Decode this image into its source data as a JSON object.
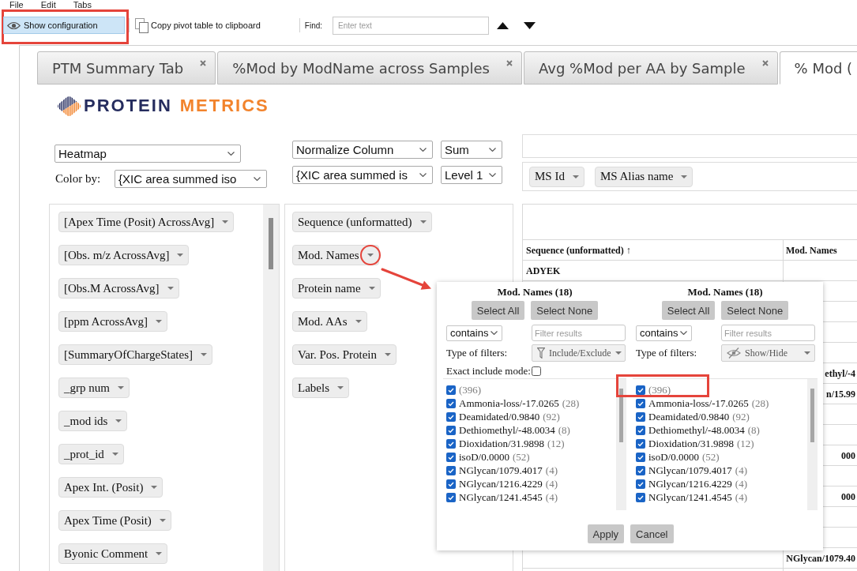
{
  "menu": [
    "File",
    "Edit",
    "Tabs"
  ],
  "toolbar": {
    "show_configuration": {
      "label": "Show configuration",
      "active": true,
      "highlighted": true
    },
    "copy_button": {
      "label": "Copy pivot table to clipboard"
    },
    "find": {
      "label": "Find:",
      "placeholder": "Enter text"
    }
  },
  "tabs": [
    {
      "label": "PTM Summary Tab",
      "selected": false,
      "closable": true
    },
    {
      "label": "%Mod by ModName across Samples",
      "selected": false,
      "closable": true
    },
    {
      "label": "Avg %Mod per AA by Sample",
      "selected": false,
      "closable": true
    },
    {
      "label": "% Mod (",
      "selected": true,
      "closable": false
    }
  ],
  "logo": {
    "primary": "PROTEIN",
    "secondary": "METRICS"
  },
  "renderer_select": {
    "value": "Heatmap"
  },
  "color_by": {
    "label": "Color by:",
    "value": "{XIC area summed iso"
  },
  "aggregator_rows": [
    {
      "main": "Normalize Column",
      "side": "Sum"
    },
    {
      "main": "{XIC area summed is",
      "side": "Level 1"
    }
  ],
  "column_fields": [
    "MS Id",
    "MS Alias name"
  ],
  "field_list": [
    "[Apex Time (Posit) AcrossAvg]",
    "[Obs. m/z AcrossAvg]",
    "[Obs.M AcrossAvg]",
    "[ppm AcrossAvg]",
    "[SummaryOfChargeStates]",
    "_grp num",
    "_mod ids",
    "_prot_id",
    "Apex Int. (Posit)",
    "Apex Time (Posit)",
    "Byonic Comment"
  ],
  "row_fields": [
    {
      "label": "Sequence (unformatted)",
      "highlighted": false
    },
    {
      "label": "Mod. Names",
      "highlighted": true
    },
    {
      "label": "Protein name",
      "highlighted": false
    },
    {
      "label": "Mod. AAs",
      "highlighted": false
    },
    {
      "label": "Var. Pos. Protein",
      "highlighted": false
    },
    {
      "label": "Labels",
      "highlighted": false
    }
  ],
  "table": {
    "columns": [
      "Sequence (unformatted) ↑",
      "Mod. Names"
    ],
    "rows": [
      {
        "sequence": "ADYEK"
      },
      {},
      {},
      {},
      {},
      {
        "mod_names": "ethyl/-4"
      },
      {
        "mod_names": "n/15.99"
      },
      {},
      {},
      {
        "mod_names": "000"
      },
      {},
      {
        "mod_names": "000"
      },
      {},
      {},
      {
        "mod_names": "NGlycan/1079.40"
      }
    ]
  },
  "filter_popup": {
    "panels": [
      {
        "title": "Mod. Names (18)",
        "buttons": [
          "Select All",
          "Select None"
        ],
        "match": "contains",
        "filter_placeholder": "Filter results",
        "filter_type_label": "Type of filters:",
        "filter_type": {
          "kind": "include_exclude",
          "label": "Include/Exclude"
        },
        "exact_include": {
          "label": "Exact include mode:",
          "checked": false
        },
        "items": [
          {
            "count": "(396)",
            "checked": true,
            "highlighted": false
          },
          {
            "name": "Ammonia-loss/-17.0265",
            "count": "(28)",
            "checked": true,
            "highlighted": false
          },
          {
            "name": "Deamidated/0.9840",
            "count": "(92)",
            "checked": true,
            "highlighted": false
          },
          {
            "name": "Dethiomethyl/-48.0034",
            "count": "(8)",
            "checked": true,
            "highlighted": false
          },
          {
            "name": "Dioxidation/31.9898",
            "count": "(12)",
            "checked": true,
            "highlighted": false
          },
          {
            "name": "isoD/0.0000",
            "count": "(52)",
            "checked": true,
            "highlighted": false
          },
          {
            "name": "NGlycan/1079.4017",
            "count": "(4)",
            "checked": true,
            "highlighted": false
          },
          {
            "name": "NGlycan/1216.4229",
            "count": "(4)",
            "checked": true,
            "highlighted": false
          },
          {
            "name": "NGlycan/1241.4545",
            "count": "(4)",
            "checked": true,
            "highlighted": false
          }
        ]
      },
      {
        "title": "Mod. Names (18)",
        "buttons": [
          "Select All",
          "Select None"
        ],
        "match": "contains",
        "filter_placeholder": "Filter results",
        "filter_type_label": "Type of filters:",
        "filter_type": {
          "kind": "show_hide",
          "label": "Show/Hide"
        },
        "items": [
          {
            "count": "(396)",
            "checked": true,
            "highlighted": true
          },
          {
            "name": "Ammonia-loss/-17.0265",
            "count": "(28)",
            "checked": true,
            "highlighted": false
          },
          {
            "name": "Deamidated/0.9840",
            "count": "(92)",
            "checked": true,
            "highlighted": false
          },
          {
            "name": "Dethiomethyl/-48.0034",
            "count": "(8)",
            "checked": true,
            "highlighted": false
          },
          {
            "name": "Dioxidation/31.9898",
            "count": "(12)",
            "checked": true,
            "highlighted": false
          },
          {
            "name": "isoD/0.0000",
            "count": "(52)",
            "checked": true,
            "highlighted": false
          },
          {
            "name": "NGlycan/1079.4017",
            "count": "(4)",
            "checked": true,
            "highlighted": false
          },
          {
            "name": "NGlycan/1216.4229",
            "count": "(4)",
            "checked": true,
            "highlighted": false
          },
          {
            "name": "NGlycan/1241.4545",
            "count": "(4)",
            "checked": true,
            "highlighted": false
          }
        ]
      }
    ],
    "buttons": [
      "Apply",
      "Cancel"
    ]
  }
}
